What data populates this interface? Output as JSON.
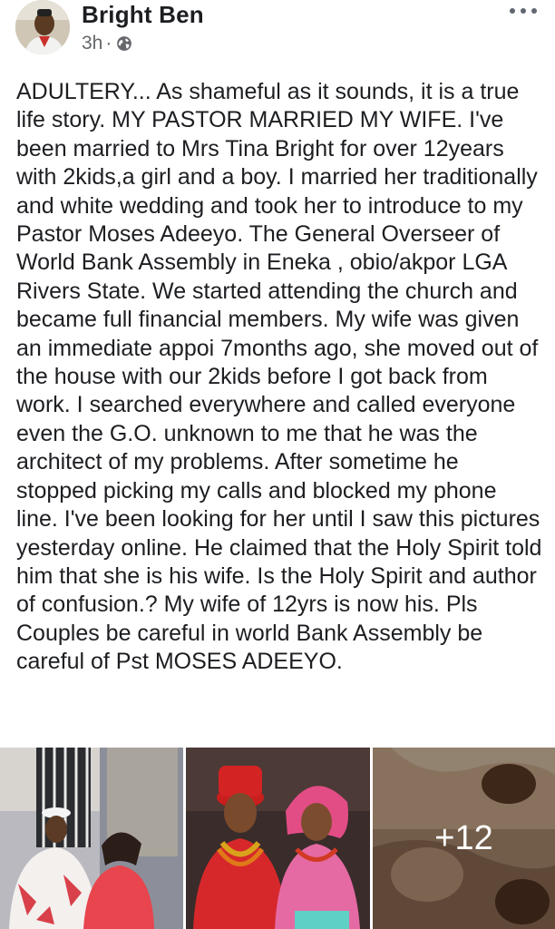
{
  "post": {
    "author": "Bright Ben",
    "time": "3h",
    "separator": "·",
    "privacy_icon": "globe-icon",
    "menu_icon": "more-options-icon",
    "text": "ADULTERY... As shameful as it sounds, it is a true life story. MY PASTOR MARRIED MY WIFE. I've been married to Mrs Tina Bright for over 12years with 2kids,a girl and a boy. I married her traditionally and white wedding and took her to introduce to my Pastor Moses Adeeyo. The General Overseer of World Bank Assembly in Eneka , obio/akpor LGA Rivers State. We started attending the church and became full financial members. My wife was given an immediate appoi 7months ago, she moved out of the house with our 2kids before I got back from work. I searched everywhere and called everyone even the G.O. unknown to me that he was the architect of my problems. After sometime he stopped picking my calls and blocked my phone line. I've been looking for her until I saw this pictures yesterday online. He claimed that the Holy Spirit told him that she is his wife. Is the Holy Spirit and author of confusion.? My wife of 12yrs is now his. Pls Couples be careful in world Bank Assembly be careful of Pst MOSES ADEEYO."
  },
  "photos": {
    "more_count": "+12"
  },
  "colors": {
    "text": "#1c1e21",
    "meta": "#65676b",
    "background": "#ffffff"
  }
}
